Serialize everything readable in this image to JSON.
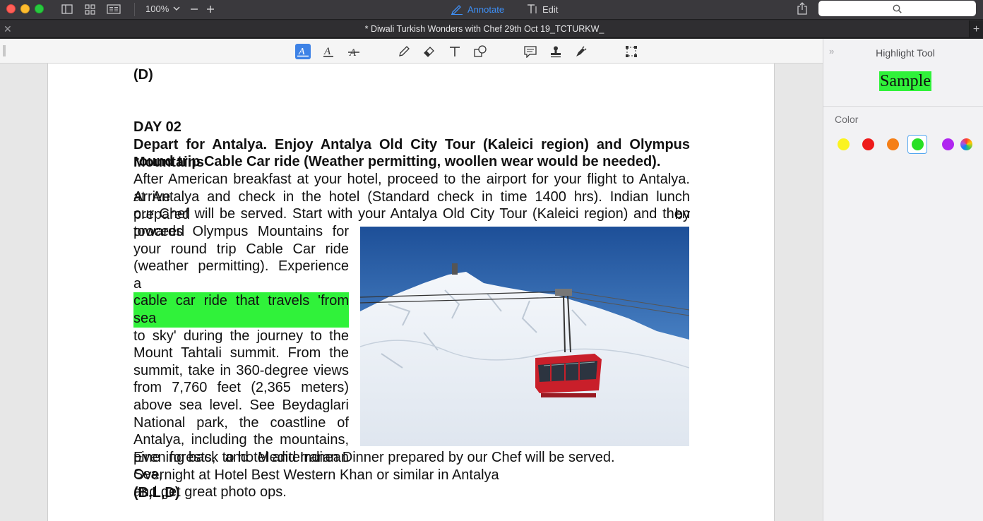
{
  "titlebar": {
    "zoom": "100%",
    "annotate_label": "Annotate",
    "edit_label": "Edit",
    "search_placeholder": ""
  },
  "tab": {
    "title": "* Diwali Turkish Wonders with Chef 29th Oct 19_TCTURKW_"
  },
  "toolbar": {
    "tools": [
      "text-highlight",
      "text-underline",
      "text-strikethrough",
      "pencil",
      "eraser",
      "text-box",
      "shapes",
      "note",
      "stamp",
      "signature",
      "selection"
    ]
  },
  "document": {
    "top_partial": "(D)",
    "day_heading": "DAY 02",
    "heading_line1": "Depart for Antalya. Enjoy Antalya Old City Tour (Kaleici region) and Olympus Mountains",
    "heading_line2": "round trip Cable Car ride (Weather permitting, woollen wear would be needed).",
    "para_lines": [
      " After American breakfast at your hotel, proceed to the airport for your flight to Antalya. Arrive",
      "at Antalya and check in the hotel (Standard check in time 1400 hrs). Indian lunch prepared by",
      "our Chef will be served. Start with your Antalya Old City Tour (Kaleici region) and then proceed"
    ],
    "col_lines": [
      "towards Olympus Mountains for",
      "your round trip Cable Car ride",
      "(weather permitting). Experience a",
      "cable car ride that travels 'from sea",
      "to sky' during the journey to the",
      "Mount Tahtali summit. From the",
      "summit, take in 360-degree views",
      "from 7,760 feet (2,365 meters)",
      "above sea level. See Beydaglari",
      "National park, the coastline of",
      "Antalya, including the mountains,",
      "pine forests, and Mediterranean Sea,",
      "and get great photo ops."
    ],
    "highlight_index": 3,
    "bottom_lines": [
      "Evening back to hotel and Indian Dinner prepared by our Chef will be served.",
      "Overnight at Hotel Best Western Khan or similar in Antalya"
    ],
    "meals": "(B,L,D)"
  },
  "sidebar": {
    "title": "Highlight Tool",
    "sample_text": "Sample",
    "color_label": "Color",
    "colors": [
      "#fbf31f",
      "#ee1b1b",
      "#f57f17",
      "#27e024",
      "#b026f0",
      "multicolor"
    ],
    "selected_color": "#27e024"
  }
}
